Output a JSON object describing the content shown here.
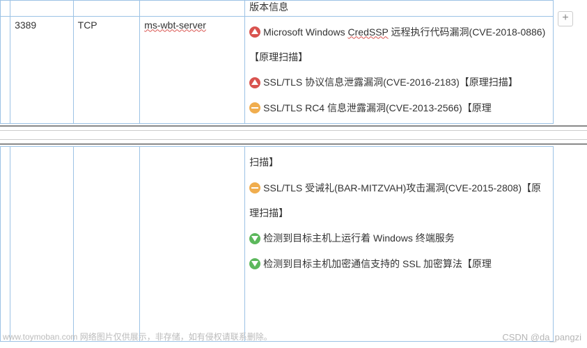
{
  "topRow": {
    "col4": "版本信息"
  },
  "mainRow": {
    "port": "3389",
    "protocol": "TCP",
    "service": "ms-wbt-server",
    "vulns_part1": [
      {
        "severity": "high",
        "text_pre": "Microsoft Windows ",
        "text_spell": "CredSSP",
        "text_post": "  远程执行代码漏洞(CVE-2018-0886)【原理扫描】"
      },
      {
        "severity": "high",
        "text_pre": "SSL/TLS 协议信息泄露漏洞(CVE-2016-2183)【原理扫描】",
        "text_spell": "",
        "text_post": ""
      },
      {
        "severity": "medium",
        "text_pre": "SSL/TLS RC4  信息泄露漏洞(CVE-2013-2566)【原理",
        "text_spell": "",
        "text_post": ""
      }
    ],
    "vulns_part2_prefix": "扫描】",
    "vulns_part2": [
      {
        "severity": "medium",
        "text_pre": "SSL/TLS  受诫礼(BAR-MITZVAH)攻击漏洞(CVE-2015-2808)【原理扫描】",
        "text_spell": "",
        "text_post": ""
      },
      {
        "severity": "low",
        "text_pre": "检测到目标主机上运行着 Windows 终端服务",
        "text_spell": "",
        "text_post": ""
      },
      {
        "severity": "low",
        "text_pre": "检测到目标主机加密通信支持的 SSL 加密算法【原理",
        "text_spell": "",
        "text_post": ""
      }
    ]
  },
  "plusButton": "+",
  "footer": {
    "site": "www.toymoban.com",
    "note": " 网络图片仅供展示，非存储，如有侵权请联系删除。"
  },
  "watermark": "CSDN @da_pangzi"
}
